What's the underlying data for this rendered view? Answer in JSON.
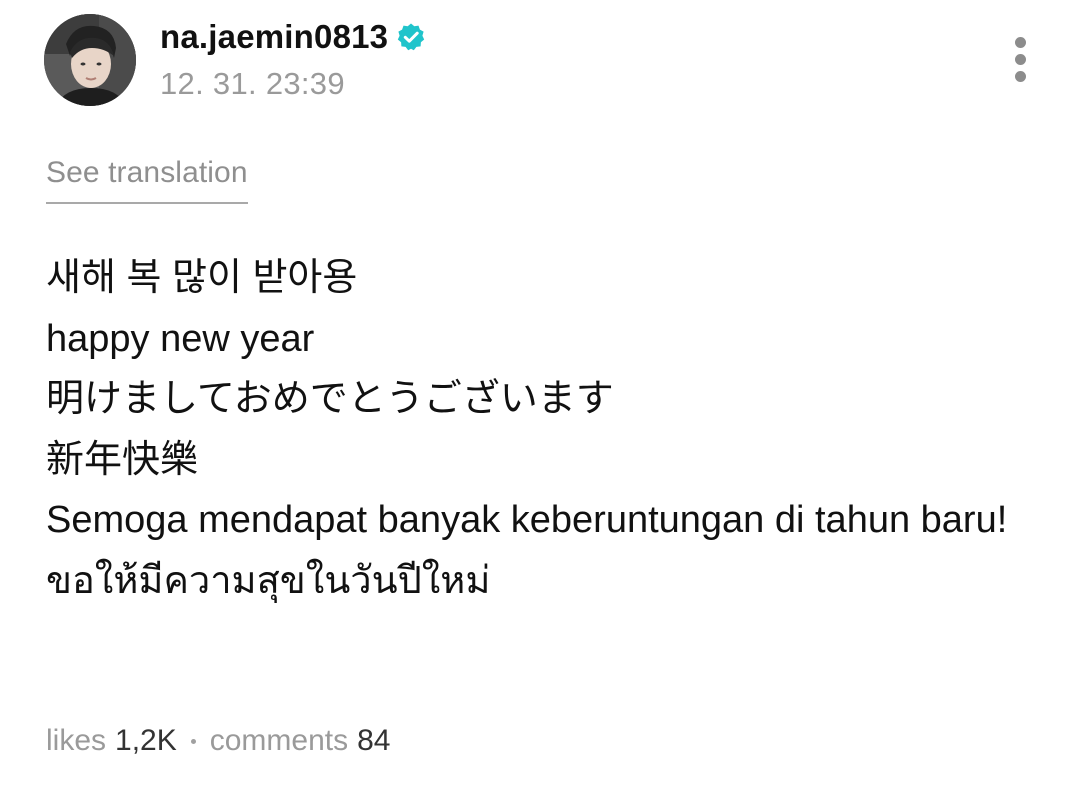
{
  "post": {
    "author": {
      "username": "na.jaemin0813",
      "verified": true,
      "avatar": "profile-photo"
    },
    "timestamp": "12. 31. 23:39",
    "translate_label": "See translation",
    "lines": [
      "새해 복 많이 받아용",
      "happy new year",
      "明けましておめでとうございます",
      "新年快樂",
      "Semoga mendapat banyak keberuntungan di tahun baru!",
      "ขอให้มีความสุขในวันปีใหม่"
    ],
    "stats": {
      "likes_label": "likes",
      "likes_value": "1,2K",
      "comments_label": "comments",
      "comments_value": "84"
    }
  },
  "icons": {
    "verified": "verified-badge-icon",
    "more": "more-vertical-icon"
  },
  "colors": {
    "verified_badge": "#20c4cb",
    "text_primary": "#111111",
    "text_muted": "#9a9a9a"
  }
}
